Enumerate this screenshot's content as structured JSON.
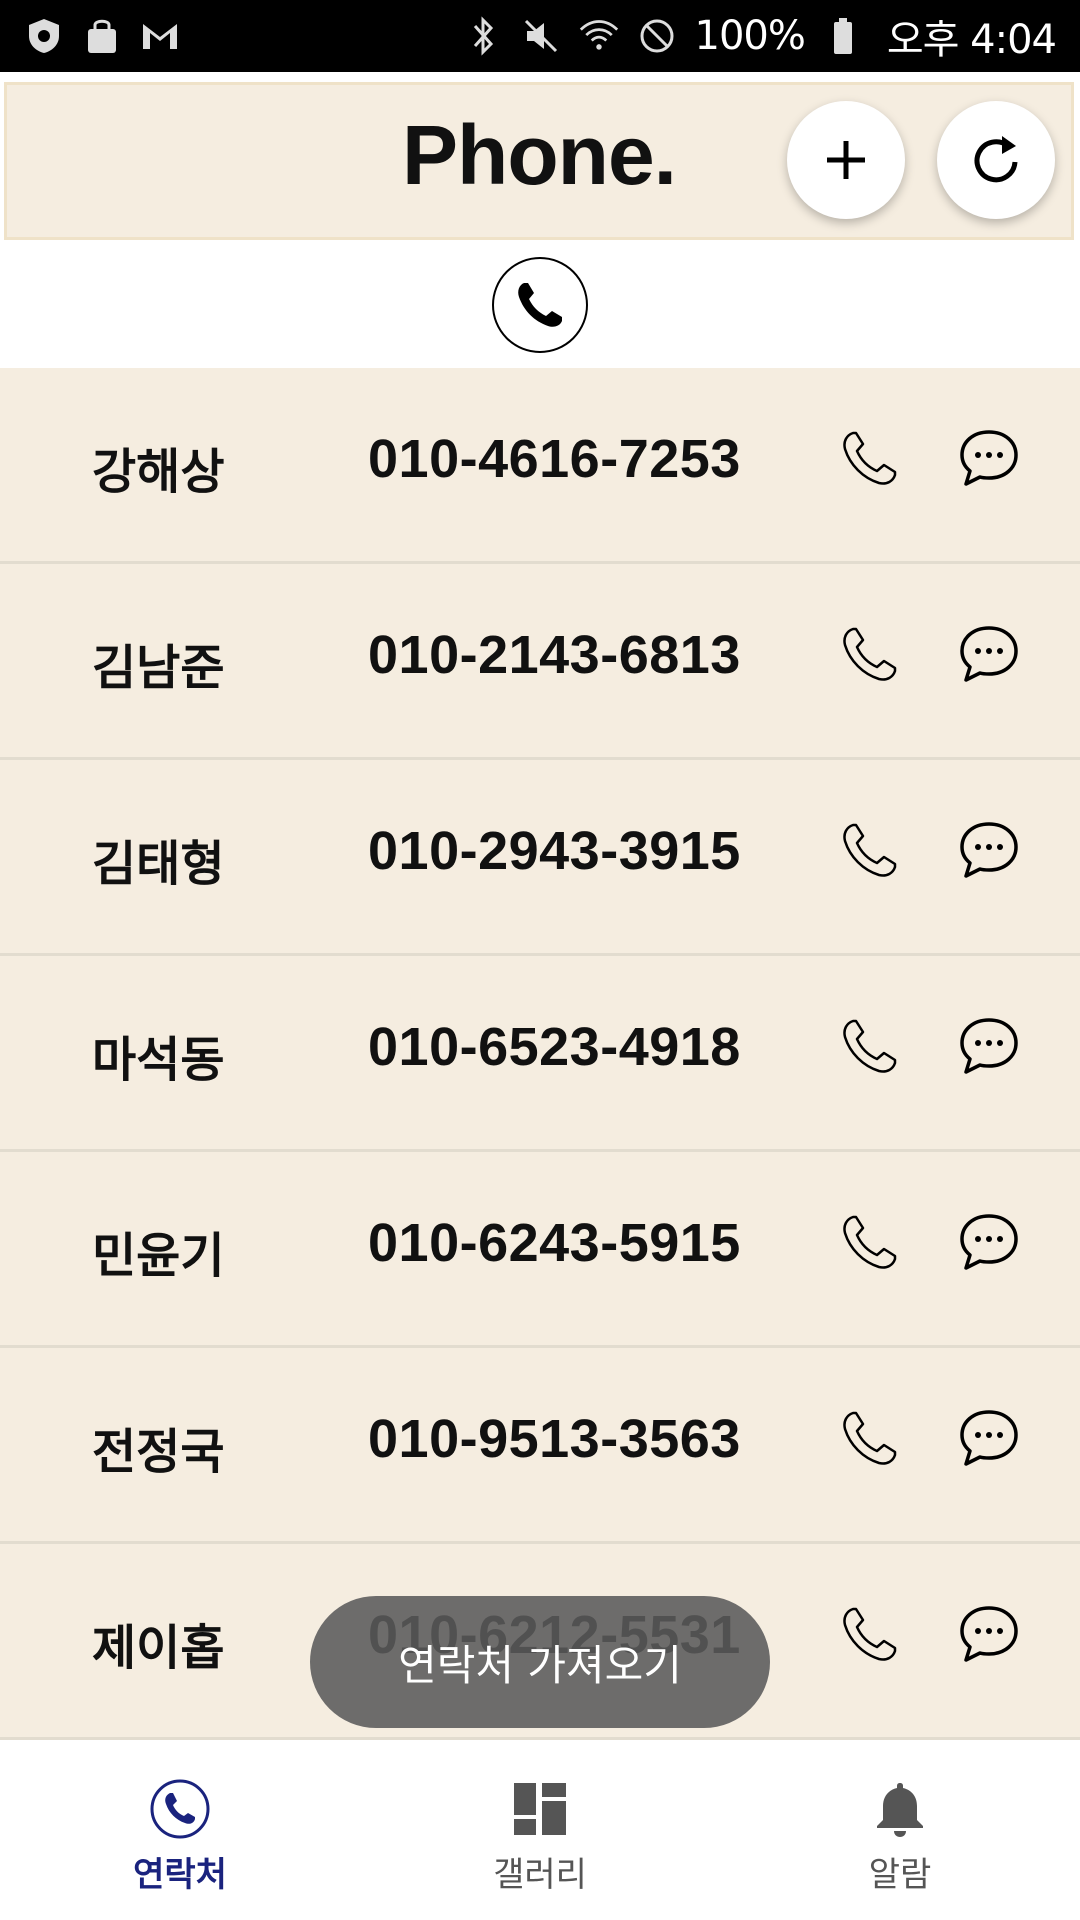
{
  "status_bar": {
    "battery": "100%",
    "time": "오후 4:04"
  },
  "header": {
    "title": "Phone."
  },
  "contacts": [
    {
      "name": "강해상",
      "phone": "010-4616-7253"
    },
    {
      "name": "김남준",
      "phone": "010-2143-6813"
    },
    {
      "name": "김태형",
      "phone": "010-2943-3915"
    },
    {
      "name": "마석동",
      "phone": "010-6523-4918"
    },
    {
      "name": "민윤기",
      "phone": "010-6243-5915"
    },
    {
      "name": "전정국",
      "phone": "010-9513-3563"
    },
    {
      "name": "제이홉",
      "phone": "010-6212-5531"
    }
  ],
  "toast": {
    "text": "연락처 가져오기"
  },
  "bottom_nav": {
    "items": [
      {
        "label": "연락처",
        "icon": "phone-icon",
        "active": true
      },
      {
        "label": "갤러리",
        "icon": "gallery-icon",
        "active": false
      },
      {
        "label": "알람",
        "icon": "bell-icon",
        "active": false
      }
    ]
  },
  "colors": {
    "header_bg": "#f5ede0",
    "row_bg": "#f5ede0",
    "active_nav": "#1a237e",
    "inactive_nav": "#555555"
  }
}
